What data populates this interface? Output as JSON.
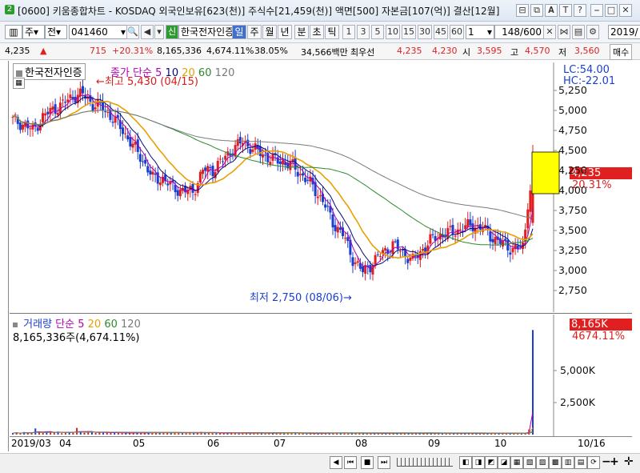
{
  "window": {
    "number": "2",
    "title": "[0600] 키움종합차트 - KOSDAQ 외국인보유[623(천)] 주식수[21,459(천)] 액면[500] 자본금[107(억)] 결산[12월]",
    "buttons": [
      "⊟",
      "⧉",
      "𝐀",
      "T",
      "?",
      "⎯",
      "□",
      "✕"
    ]
  },
  "toolbar": {
    "chart_type": "주",
    "period_mode": "전",
    "stock_code": "041460",
    "sin_badge": "신",
    "stock_name": "한국전자인증",
    "period_buttons": [
      "일",
      "주",
      "월",
      "년",
      "분",
      "초",
      "틱"
    ],
    "active_period": "일",
    "interval_buttons": [
      "1",
      "3",
      "5",
      "10",
      "15",
      "30",
      "45",
      "60"
    ],
    "count_value": "1",
    "page_display": "148/600",
    "date_value": "2019/"
  },
  "quote": {
    "price": "4,235",
    "change_arrow": "▲",
    "change": "715",
    "change_pct": "+20.31%",
    "volume": "8,165,336",
    "volume_pct": "4,674.11%",
    "turnover_pct": "38.05%",
    "amount": "34,566백만",
    "best_bid_label": "최우선",
    "best_ask": "4,235",
    "best_bid": "4,230",
    "open_label": "시",
    "open": "3,595",
    "high_label": "고",
    "high": "4,570",
    "low_label": "저",
    "low": "3,560",
    "trade_label": "매수"
  },
  "price_pane": {
    "stock_label": "한국전자인증",
    "ma_title": "종가 단순",
    "ma_periods": [
      "5",
      "10",
      "20",
      "60",
      "120"
    ],
    "ma_colors": [
      "#0a0a7a",
      "#e8a000",
      "#2a8a2a",
      "#7a7a7a"
    ],
    "high_annotation": "최고 5,430 (04/15)",
    "low_annotation": "최저 2,750 (08/06)",
    "lc": "LC:54.00",
    "hc": "HC:-22.01",
    "current_price_label": "4,235",
    "current_pct_label": "20.31%",
    "up_color": "#e02020",
    "down_color": "#1a3fd0"
  },
  "volume_pane": {
    "title": "거래량",
    "ma_title": "단순",
    "ma_periods": [
      "5",
      "20",
      "60",
      "120"
    ],
    "readout": "8,165,336주(4,674.11%)",
    "current_volume_label": "8,165K",
    "current_pct_label": "4674.11%"
  },
  "date_axis": {
    "labels": [
      "2019/03",
      "04",
      "05",
      "06",
      "07",
      "08",
      "09",
      "10",
      "10/16"
    ]
  },
  "bottom_toolbar": {
    "buttons": [
      "◀",
      "⏮",
      "■",
      "⏭"
    ],
    "zoom_buttons": [
      "−",
      "+"
    ]
  },
  "chart_data": [
    {
      "type": "candlestick",
      "title": "",
      "y_axis_ticks": [
        "5,250",
        "5,000",
        "4,750",
        "4,500",
        "4,250",
        "4,000",
        "3,750",
        "3,500",
        "3,250",
        "3,000",
        "2,750"
      ],
      "ylim": [
        2600,
        5500
      ],
      "x_range": [
        "2019-03-04",
        "2019-10-16"
      ],
      "series": [
        {
          "name": "종가",
          "points": [
            [
              0,
              4880
            ],
            [
              4,
              4830
            ],
            [
              8,
              4750
            ],
            [
              12,
              4920
            ],
            [
              16,
              5010
            ],
            [
              20,
              5080
            ],
            [
              24,
              5180
            ],
            [
              28,
              5200
            ],
            [
              32,
              5080
            ],
            [
              36,
              5030
            ],
            [
              40,
              4900
            ],
            [
              44,
              4750
            ],
            [
              48,
              4560
            ],
            [
              52,
              4380
            ],
            [
              56,
              4150
            ],
            [
              60,
              4150
            ],
            [
              64,
              4030
            ],
            [
              68,
              4000
            ],
            [
              72,
              3980
            ],
            [
              76,
              4250
            ],
            [
              80,
              4260
            ],
            [
              84,
              4380
            ],
            [
              88,
              4520
            ],
            [
              92,
              4610
            ],
            [
              96,
              4520
            ],
            [
              100,
              4450
            ],
            [
              104,
              4380
            ],
            [
              108,
              4360
            ],
            [
              112,
              4300
            ],
            [
              116,
              4180
            ],
            [
              120,
              4050
            ],
            [
              124,
              3870
            ],
            [
              128,
              3600
            ],
            [
              132,
              3450
            ],
            [
              136,
              3150
            ],
            [
              140,
              2980
            ],
            [
              144,
              3100
            ],
            [
              148,
              3230
            ],
            [
              152,
              3320
            ],
            [
              156,
              3230
            ],
            [
              160,
              3120
            ],
            [
              164,
              3270
            ],
            [
              168,
              3400
            ],
            [
              172,
              3460
            ],
            [
              176,
              3480
            ],
            [
              180,
              3530
            ],
            [
              184,
              3570
            ],
            [
              188,
              3520
            ],
            [
              192,
              3410
            ],
            [
              196,
              3330
            ],
            [
              200,
              3270
            ],
            [
              204,
              3290
            ],
            [
              208,
              4235
            ]
          ]
        },
        {
          "name": "5",
          "values": "same-as-drawn"
        },
        {
          "name": "20",
          "values": "same-as-drawn"
        },
        {
          "name": "60",
          "values": "same-as-drawn"
        },
        {
          "name": "120",
          "values": "same-as-drawn"
        }
      ],
      "high": {
        "value": 5430,
        "date": "04/15"
      },
      "low": {
        "value": 2750,
        "date": "08/06"
      },
      "last": {
        "value": 4235,
        "change_pct": 20.31
      }
    },
    {
      "type": "bar",
      "title": "거래량",
      "y_axis_ticks": [
        "5,000K",
        "2,500K"
      ],
      "ylim": [
        0,
        8500
      ],
      "values_k": [
        120,
        150,
        90,
        200,
        130,
        110,
        480,
        170,
        140,
        220,
        160,
        200,
        240,
        110,
        130,
        200,
        180,
        520,
        160,
        140,
        210,
        190,
        130,
        170,
        150,
        180,
        160,
        140,
        120,
        110,
        140,
        130,
        120,
        150,
        110,
        130,
        160,
        110,
        150,
        140,
        140,
        160,
        140,
        170,
        130,
        110,
        120,
        100,
        150,
        130,
        210,
        120,
        140,
        110,
        90,
        120,
        150,
        110,
        100,
        130,
        80,
        110,
        90,
        120,
        100,
        140,
        130,
        80,
        110,
        100,
        90,
        140,
        170,
        120,
        150,
        100,
        90,
        110,
        70,
        80,
        100,
        90,
        110,
        120,
        130,
        140,
        110,
        120,
        150,
        110,
        90,
        140,
        120,
        110,
        80,
        90,
        100,
        110,
        90,
        80,
        120,
        90,
        110,
        150,
        120,
        100,
        110,
        130,
        90,
        80,
        100,
        140,
        130,
        120,
        110,
        90,
        100,
        110,
        100,
        90,
        110,
        100,
        80,
        90,
        100,
        90,
        110,
        90,
        100,
        80,
        90,
        100,
        90,
        110,
        100,
        90,
        130,
        400,
        8165
      ]
    }
  ]
}
